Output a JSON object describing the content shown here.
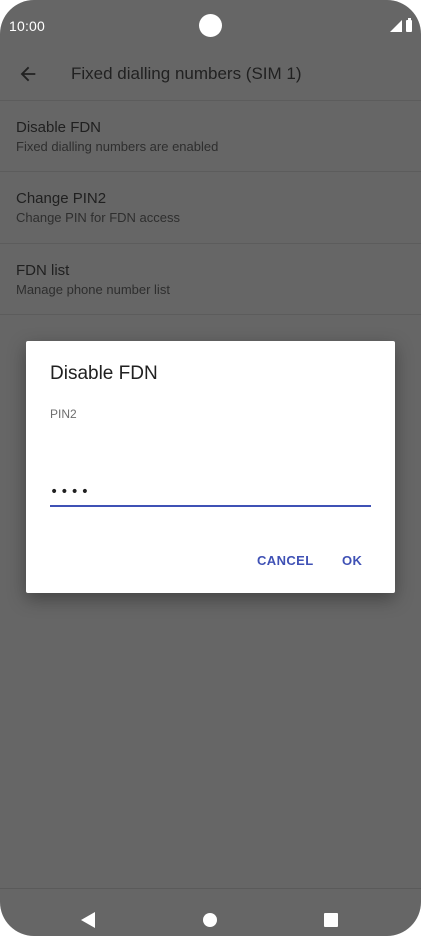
{
  "status_bar": {
    "time": "10:00",
    "icons": [
      "front-camera-icon",
      "signal-icon",
      "battery-icon"
    ]
  },
  "app_bar": {
    "back_icon": "arrow-back-icon",
    "title": "Fixed dialling numbers (SIM 1)"
  },
  "list": [
    {
      "title": "Disable FDN",
      "summary": "Fixed dialling numbers are enabled"
    },
    {
      "title": "Change PIN2",
      "summary": "Change PIN for FDN access"
    },
    {
      "title": "FDN list",
      "summary": "Manage phone number list"
    }
  ],
  "dialog": {
    "title": "Disable FDN",
    "field_label": "PIN2",
    "pin_value": "••••",
    "cancel_label": "CANCEL",
    "ok_label": "OK"
  },
  "nav_bar": {
    "icons": [
      "nav-back-icon",
      "nav-home-icon",
      "nav-recents-icon"
    ]
  },
  "colors": {
    "scrim_background": "#666666",
    "accent": "#3f51b5",
    "dialog_background": "#ffffff"
  }
}
